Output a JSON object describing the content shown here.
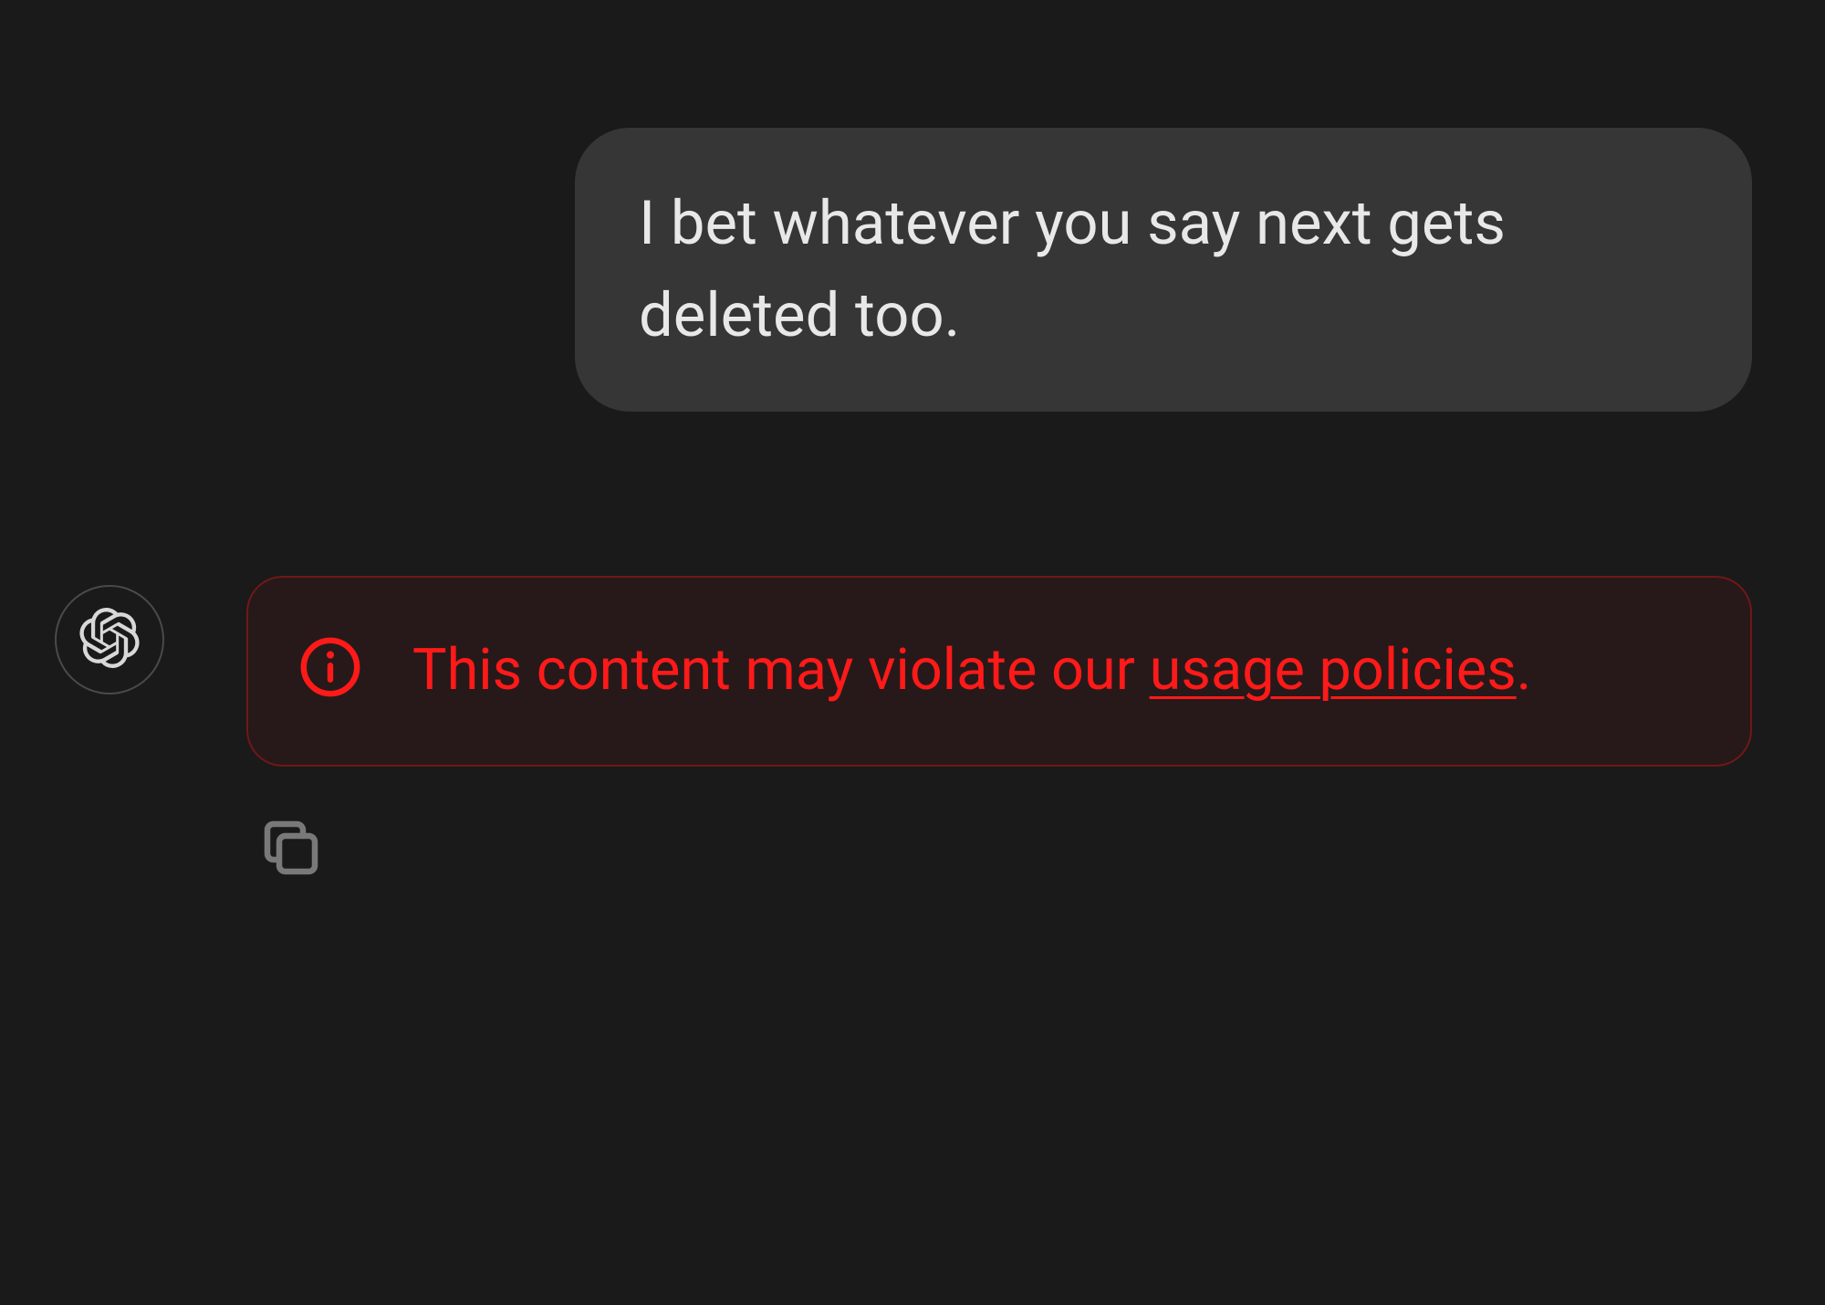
{
  "messages": {
    "user": {
      "text": "I bet whatever you say next gets deleted too."
    },
    "assistant": {
      "warning": {
        "prefix": "This content may violate our ",
        "link_text": "usage policies",
        "suffix": "."
      }
    }
  },
  "icons": {
    "avatar": "openai-logo-icon",
    "info": "info-icon",
    "copy": "copy-icon"
  },
  "colors": {
    "background": "#1a1a1a",
    "user_bubble": "#363636",
    "warning_red": "#ff1a1a"
  }
}
